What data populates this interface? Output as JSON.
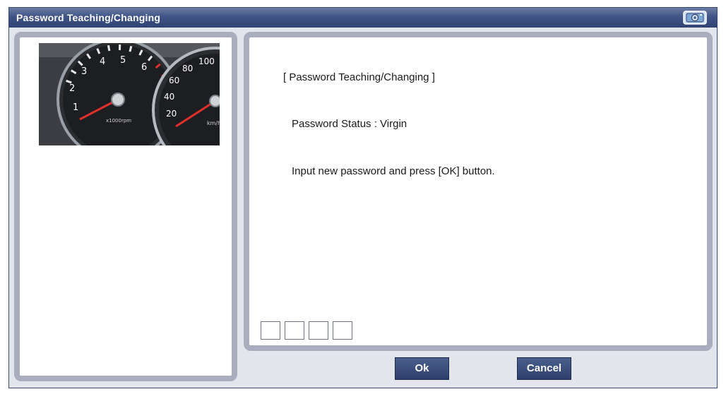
{
  "window": {
    "title": "Password Teaching/Changing"
  },
  "content": {
    "heading": "[ Password Teaching/Changing ]",
    "status": "Password Status : Virgin",
    "instruction": "Input new password and press [OK] button."
  },
  "password_input": {
    "digit_count": 4,
    "digits": [
      "",
      "",
      "",
      ""
    ]
  },
  "buttons": {
    "ok_label": "Ok",
    "cancel_label": "Cancel"
  },
  "gauge_image": {
    "tachometer_ticks": [
      "1",
      "2",
      "3",
      "4",
      "5",
      "6"
    ],
    "tachometer_unit": "x1000rpm",
    "speedometer_ticks": [
      "20",
      "40",
      "60",
      "80",
      "100"
    ],
    "speedometer_unit": "km/h"
  },
  "colors": {
    "title_bar": "#3f5486",
    "panel_border": "#a9aebe",
    "button_bg": "#2d3f6d",
    "needle": "#e0302a"
  },
  "icons": {
    "title_bar_right": "camera-icon"
  }
}
